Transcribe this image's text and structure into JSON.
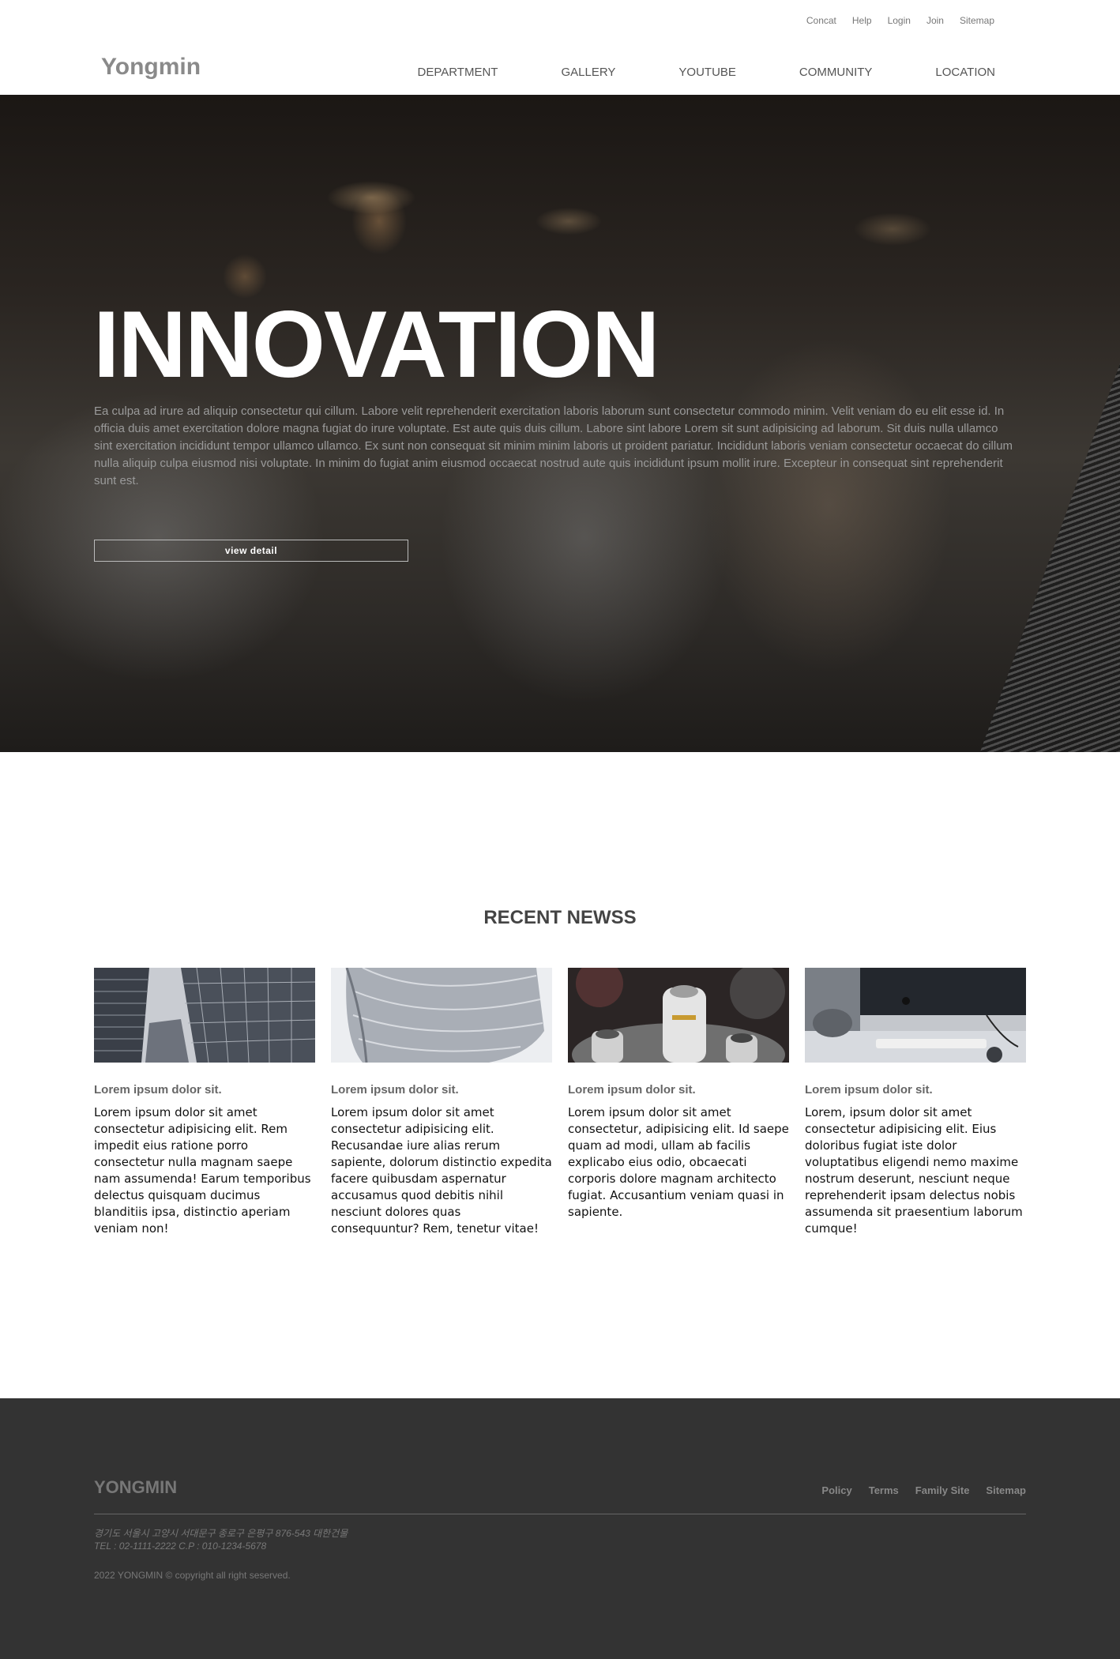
{
  "header": {
    "logo": "Yongmin",
    "util_links": [
      "Concat",
      "Help",
      "Login",
      "Join",
      "Sitemap"
    ],
    "nav": [
      "DEPARTMENT",
      "GALLERY",
      "YOUTUBE",
      "COMMUNITY",
      "LOCATION"
    ]
  },
  "hero": {
    "title": "INNOVATION",
    "text": "Ea culpa ad irure ad aliquip consectetur qui cillum. Labore velit reprehenderit exercitation laboris laborum sunt consectetur commodo minim. Velit veniam do eu elit esse id. In officia duis amet exercitation dolore magna fugiat do irure voluptate. Est aute quis duis cillum. Labore sint labore Lorem sit sunt adipisicing ad laborum. Sit duis nulla ullamco sint exercitation incididunt tempor ullamco ullamco. Ex sunt non consequat sit minim minim laboris ut proident pariatur. Incididunt laboris veniam consectetur occaecat do cillum nulla aliquip culpa eiusmod nisi voluptate. In minim do fugiat anim eiusmod occaecat nostrud aute quis incididunt ipsum mollit irure. Excepteur in consequat sint reprehenderit sunt est.",
    "button": "view detail"
  },
  "news": {
    "title": "RECENT NEWSS",
    "items": [
      {
        "title": "Lorem ipsum dolor sit.",
        "text": "Lorem ipsum dolor sit amet consectetur adipisicing elit. Rem impedit eius ratione porro consectetur nulla magnam saepe nam assumenda! Earum temporibus delectus quisquam ducimus blanditiis ipsa, distinctio aperiam veniam non!",
        "image": "skyscraper-photo"
      },
      {
        "title": "Lorem ipsum dolor sit.",
        "text": "Lorem ipsum dolor sit amet consectetur adipisicing elit. Recusandae iure alias rerum sapiente, dolorum distinctio expedita facere quibusdam aspernatur accusamus quod debitis nihil nesciunt dolores quas consequuntur? Rem, tenetur vitae!",
        "image": "metal-architecture-photo"
      },
      {
        "title": "Lorem ipsum dolor sit.",
        "text": "Lorem ipsum dolor sit amet consectetur, adipisicing elit. Id saepe quam ad modi, ullam ab facilis explicabo eius odio, obcaecati corporis dolore magnam architecto fugiat. Accusantium veniam quasi in sapiente.",
        "image": "bottles-in-ice-photo"
      },
      {
        "title": "Lorem ipsum dolor sit.",
        "text": "Lorem, ipsum dolor sit amet consectetur adipisicing elit. Eius doloribus fugiat iste dolor voluptatibus eligendi nemo maxime nostrum deserunt, nesciunt neque reprehenderit ipsam delectus nobis assumenda sit praesentium laborum cumque!",
        "image": "desk-computer-photo"
      }
    ]
  },
  "footer": {
    "logo": "YONGMIN",
    "links": [
      "Policy",
      "Terms",
      "Family Site",
      "Sitemap"
    ],
    "address": "경기도 서울시 고양시 서대문구 종로구 은평구 876-543 대한건물",
    "tel": "TEL : 02-1111-2222 C.P : 010-1234-5678",
    "copyright": "2022 YONGMIN © copyright all right seserved."
  },
  "colors": {
    "footer_bg": "#333333",
    "logo_gray": "#8a8a8a",
    "hero_text": "#9a9a9a"
  }
}
